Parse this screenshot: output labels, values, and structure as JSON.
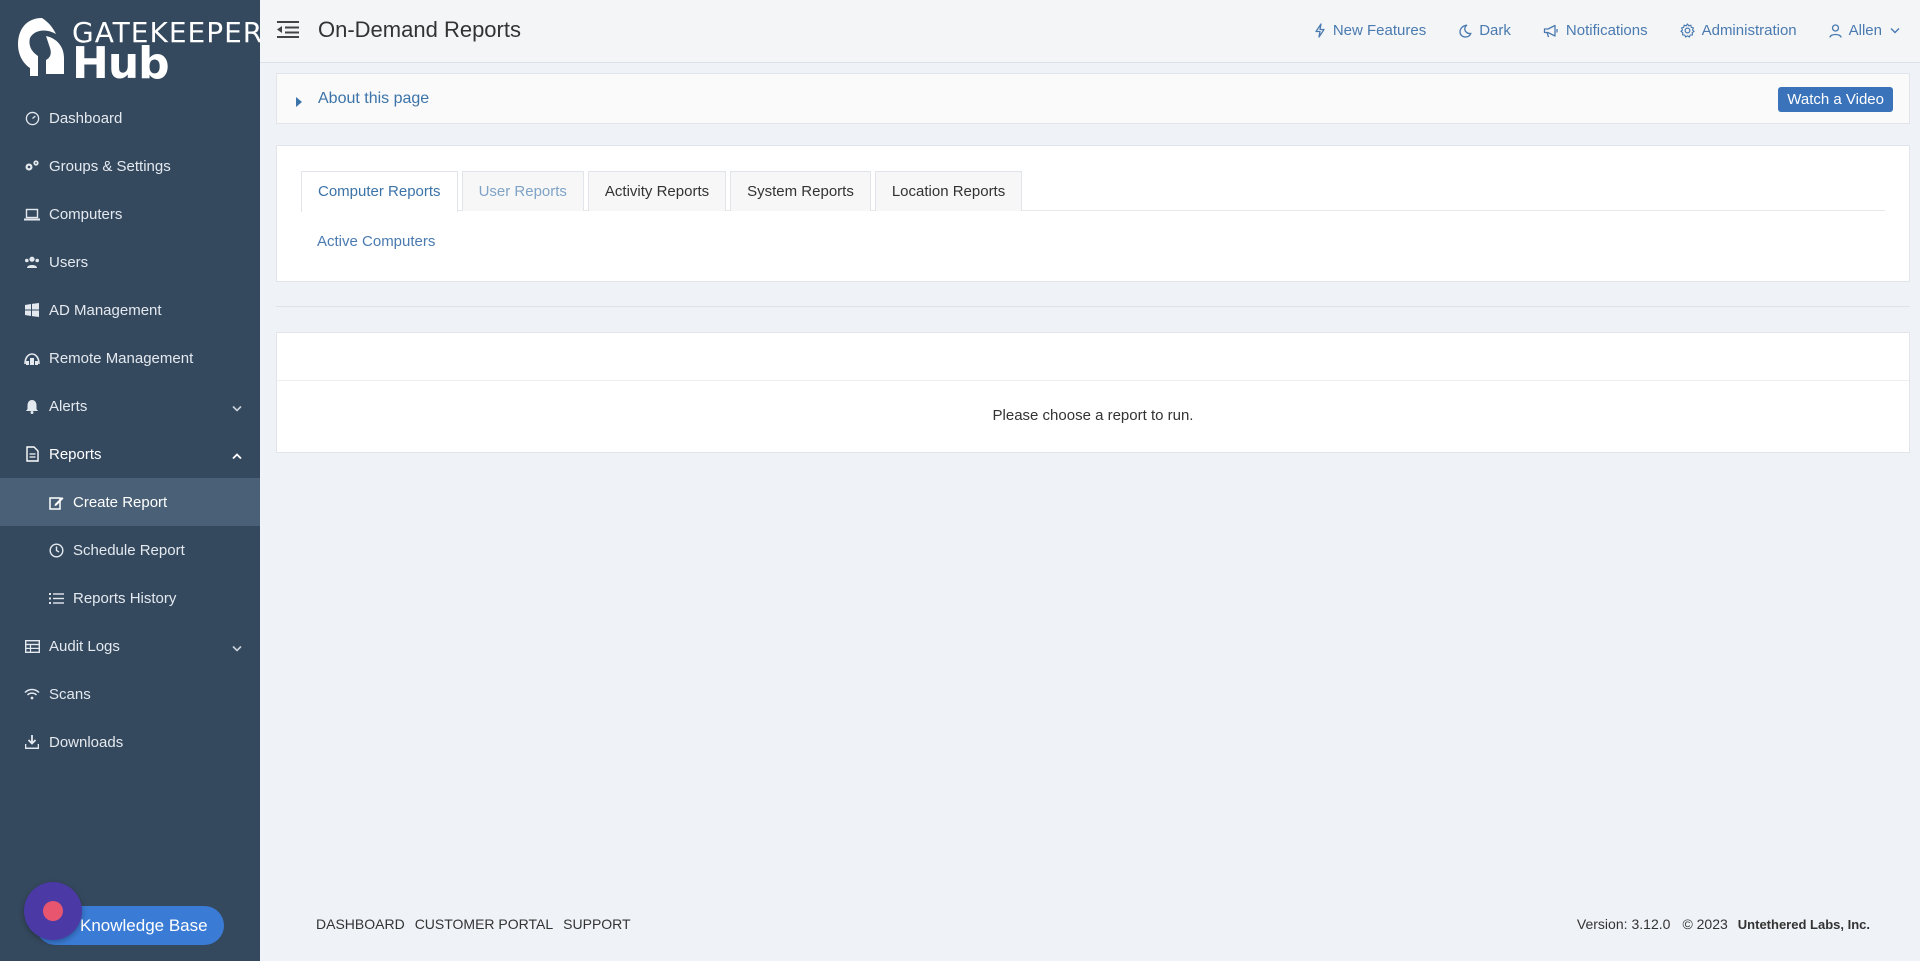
{
  "brand": {
    "line1": "GATEKEEPER",
    "line2": "Hub"
  },
  "sidebar": {
    "items": [
      {
        "label": "Dashboard"
      },
      {
        "label": "Groups & Settings"
      },
      {
        "label": "Computers"
      },
      {
        "label": "Users"
      },
      {
        "label": "AD Management"
      },
      {
        "label": "Remote Management"
      },
      {
        "label": "Alerts"
      },
      {
        "label": "Reports"
      },
      {
        "label": "Create Report"
      },
      {
        "label": "Schedule Report"
      },
      {
        "label": "Reports History"
      },
      {
        "label": "Audit Logs"
      },
      {
        "label": "Scans"
      },
      {
        "label": "Downloads"
      }
    ],
    "knowledge_base": "Knowledge Base"
  },
  "header": {
    "title": "On-Demand Reports",
    "links": {
      "new_features": "New Features",
      "dark": "Dark",
      "notifications": "Notifications",
      "administration": "Administration",
      "user": "Allen"
    }
  },
  "about": {
    "label": "About this page",
    "watch": "Watch a Video"
  },
  "tabs": [
    {
      "label": "Computer Reports"
    },
    {
      "label": "User Reports"
    },
    {
      "label": "Activity Reports"
    },
    {
      "label": "System Reports"
    },
    {
      "label": "Location Reports"
    }
  ],
  "reports": {
    "active_computers": "Active Computers"
  },
  "result": {
    "message": "Please choose a report to run."
  },
  "footer": {
    "links": [
      "DASHBOARD",
      "CUSTOMER PORTAL",
      "SUPPORT"
    ],
    "version_label": "Version:",
    "version": "3.12.0",
    "copyright": "© 2023",
    "company": "Untethered Labs, Inc."
  },
  "colors": {
    "sidebar_bg": "#35495e",
    "sidebar_active": "#4a6076",
    "accent": "#3a73ba",
    "link": "#4a7ab0"
  }
}
